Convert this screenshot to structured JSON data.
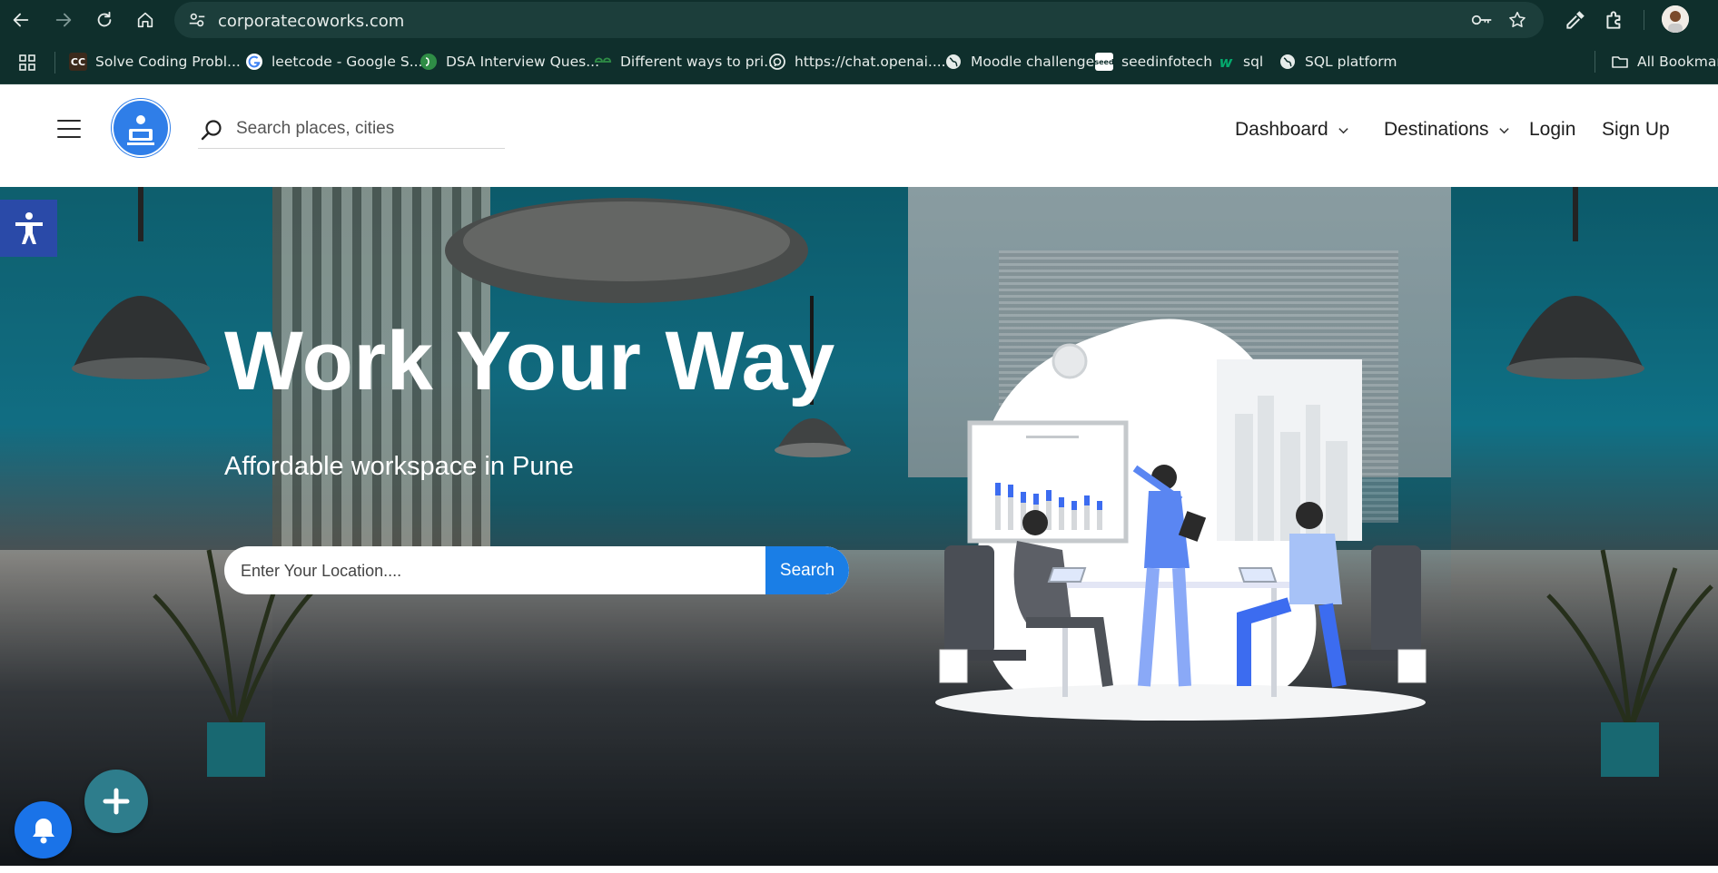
{
  "browser": {
    "url": "corporatecoworks.com",
    "bookmarks": [
      {
        "label": "Solve Coding Probl...",
        "icon": "codechef-icon",
        "fav_text": "CC",
        "fav_color": "#5b3a1e"
      },
      {
        "label": "leetcode - Google S...",
        "icon": "google-icon",
        "fav_text": "G",
        "fav_color": "#ffffff"
      },
      {
        "label": "DSA Interview Ques...",
        "icon": "gfg-green-icon",
        "fav_text": "",
        "fav_color": "#2f8d46"
      },
      {
        "label": "Different ways to pri...",
        "icon": "geeksforgeeks-icon",
        "fav_text": "",
        "fav_color": "#2f8d46"
      },
      {
        "label": "https://chat.openai....",
        "icon": "openai-icon",
        "fav_text": "",
        "fav_color": "#ffffff"
      },
      {
        "label": "Moodle challenge",
        "icon": "globe-icon",
        "fav_text": "",
        "fav_color": "#e6ecea"
      },
      {
        "label": "seedinfotech",
        "icon": "seed-icon",
        "fav_text": "",
        "fav_color": "#ffffff"
      },
      {
        "label": "sql",
        "icon": "w3schools-icon",
        "fav_text": "w",
        "fav_color": "#04aa6d"
      },
      {
        "label": "SQL platform",
        "icon": "globe-icon",
        "fav_text": "",
        "fav_color": "#e6ecea"
      }
    ],
    "all_bookmarks": "All Bookmarks"
  },
  "header": {
    "search_placeholder": "Search places, cities",
    "nav": {
      "dashboard": "Dashboard",
      "destinations": "Destinations",
      "login": "Login",
      "signup": "Sign Up"
    }
  },
  "hero": {
    "title": "Work Your Way",
    "subtitle": "Affordable workspace in Pune",
    "search_placeholder": "Enter Your Location....",
    "search_button": "Search"
  },
  "colors": {
    "chrome_bg": "#0f2f2c",
    "accent_blue": "#1a7ee6",
    "accessibility_blue": "#2a4aa8",
    "fab_teal": "#2e7d8c"
  }
}
